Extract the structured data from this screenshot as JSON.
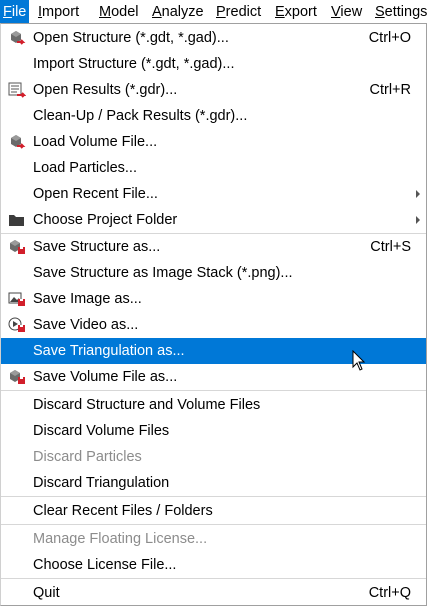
{
  "menubar": {
    "items": [
      {
        "label": "File",
        "mnemonic": "F"
      },
      {
        "label": "Import",
        "mnemonic": "I"
      },
      {
        "label": "Model",
        "mnemonic": "M"
      },
      {
        "label": "Analyze",
        "mnemonic": "A"
      },
      {
        "label": "Predict",
        "mnemonic": "P"
      },
      {
        "label": "Export",
        "mnemonic": "E"
      },
      {
        "label": "View",
        "mnemonic": "V"
      },
      {
        "label": "Settings",
        "mnemonic": "S"
      }
    ]
  },
  "file_menu": {
    "items": [
      {
        "label": "Open Structure (*.gdt, *.gad)...",
        "shortcut": "Ctrl+O",
        "icon": "open-structure-icon"
      },
      {
        "label": "Import Structure (*.gdt, *.gad)..."
      },
      {
        "label": "Open Results (*.gdr)...",
        "shortcut": "Ctrl+R",
        "icon": "open-results-icon"
      },
      {
        "label": "Clean-Up / Pack Results (*.gdr)..."
      },
      {
        "label": "Load Volume File...",
        "icon": "load-volume-icon"
      },
      {
        "label": "Load Particles..."
      },
      {
        "label": "Open Recent File...",
        "submenu": true
      },
      {
        "label": "Choose Project Folder",
        "submenu": true,
        "icon": "folder-icon"
      },
      {
        "label": "Save Structure as...",
        "shortcut": "Ctrl+S",
        "icon": "save-structure-icon"
      },
      {
        "label": "Save Structure as Image Stack (*.png)..."
      },
      {
        "label": "Save Image as...",
        "icon": "save-image-icon"
      },
      {
        "label": "Save Video as...",
        "icon": "save-video-icon"
      },
      {
        "label": "Save Triangulation as...",
        "selected": true
      },
      {
        "label": "Save Volume File as...",
        "icon": "save-volume-icon"
      },
      {
        "label": "Discard Structure and Volume Files"
      },
      {
        "label": "Discard Volume Files"
      },
      {
        "label": "Discard Particles",
        "disabled": true
      },
      {
        "label": "Discard Triangulation"
      },
      {
        "label": "Clear Recent Files / Folders"
      },
      {
        "label": "Manage Floating License...",
        "disabled": true
      },
      {
        "label": "Choose License File..."
      },
      {
        "label": "Quit",
        "shortcut": "Ctrl+Q"
      }
    ]
  },
  "colors": {
    "selection": "#0078d7",
    "disabled_text": "#8c8c8c",
    "separator": "#d7d7d7"
  }
}
